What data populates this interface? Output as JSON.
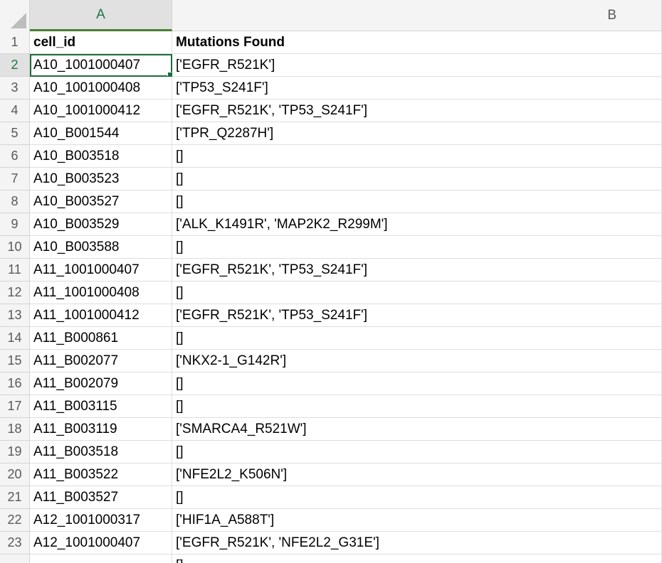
{
  "columns": [
    "A",
    "B"
  ],
  "selected_cell": "A2",
  "rows": [
    {
      "num": "1",
      "a": "cell_id",
      "b": "Mutations Found"
    },
    {
      "num": "2",
      "a": "A10_1001000407",
      "b": "['EGFR_R521K']"
    },
    {
      "num": "3",
      "a": "A10_1001000408",
      "b": "['TP53_S241F']"
    },
    {
      "num": "4",
      "a": "A10_1001000412",
      "b": "['EGFR_R521K', 'TP53_S241F']"
    },
    {
      "num": "5",
      "a": "A10_B001544",
      "b": "['TPR_Q2287H']"
    },
    {
      "num": "6",
      "a": "A10_B003518",
      "b": "[]"
    },
    {
      "num": "7",
      "a": "A10_B003523",
      "b": "[]"
    },
    {
      "num": "8",
      "a": "A10_B003527",
      "b": "[]"
    },
    {
      "num": "9",
      "a": "A10_B003529",
      "b": "['ALK_K1491R', 'MAP2K2_R299M']"
    },
    {
      "num": "10",
      "a": "A10_B003588",
      "b": "[]"
    },
    {
      "num": "11",
      "a": "A11_1001000407",
      "b": "['EGFR_R521K', 'TP53_S241F']"
    },
    {
      "num": "12",
      "a": "A11_1001000408",
      "b": "[]"
    },
    {
      "num": "13",
      "a": "A11_1001000412",
      "b": "['EGFR_R521K', 'TP53_S241F']"
    },
    {
      "num": "14",
      "a": "A11_B000861",
      "b": "[]"
    },
    {
      "num": "15",
      "a": "A11_B002077",
      "b": "['NKX2-1_G142R']"
    },
    {
      "num": "16",
      "a": "A11_B002079",
      "b": "[]"
    },
    {
      "num": "17",
      "a": "A11_B003115",
      "b": "[]"
    },
    {
      "num": "18",
      "a": "A11_B003119",
      "b": "['SMARCA4_R521W']"
    },
    {
      "num": "19",
      "a": "A11_B003518",
      "b": "[]"
    },
    {
      "num": "20",
      "a": "A11_B003522",
      "b": "['NFE2L2_K506N']"
    },
    {
      "num": "21",
      "a": "A11_B003527",
      "b": "[]"
    },
    {
      "num": "22",
      "a": "A12_1001000317",
      "b": "['HIF1A_A588T']"
    },
    {
      "num": "23",
      "a": "A12_1001000407",
      "b": "['EGFR_R521K', 'NFE2L2_G31E']"
    },
    {
      "num": "",
      "a": "",
      "b": "[]"
    }
  ]
}
